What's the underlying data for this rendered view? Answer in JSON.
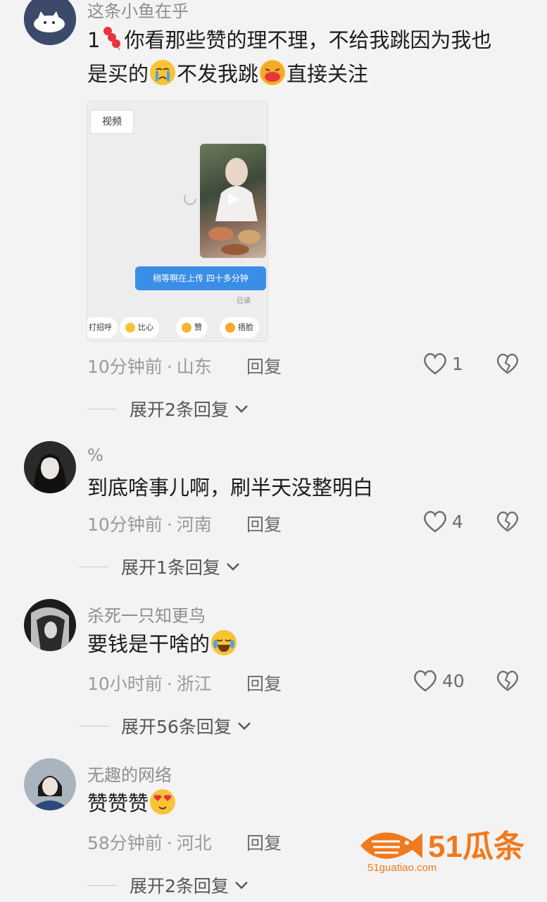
{
  "comments": [
    {
      "username": "这条小鱼在乎",
      "text_parts": [
        "1",
        "你看那些赞的理不理，不给我跳因为我也",
        "是买的",
        "不发我跳",
        "直接关注"
      ],
      "time": "10分钟前",
      "location": "山东",
      "reply_label": "回复",
      "likes": "1",
      "expand": "展开2条回复",
      "screenshot": {
        "tag": "视频",
        "bubble": "稍等啊在上传 四十多分钟",
        "read": "已读",
        "quick_replies": [
          "打招呼",
          "比心",
          "赞",
          "捂脸"
        ]
      }
    },
    {
      "username": "%",
      "text": "到底啥事儿啊，刷半天没整明白",
      "time": "10分钟前",
      "location": "河南",
      "reply_label": "回复",
      "likes": "4",
      "expand": "展开1条回复"
    },
    {
      "username": "杀死一只知更鸟",
      "text": "要钱是干啥的",
      "time": "10小时前",
      "location": "浙江",
      "reply_label": "回复",
      "likes": "40",
      "expand": "展开56条回复"
    },
    {
      "username": "无趣的网络",
      "text": "赞赞赞",
      "time": "58分钟前",
      "location": "河北",
      "reply_label": "回复",
      "likes": "",
      "expand": "展开2条回复"
    }
  ],
  "separator": "·",
  "watermark": {
    "brand": "51瓜条",
    "url": "51guatiao.com"
  },
  "icons": {
    "like": "heart-outline-icon",
    "dislike": "broken-heart-icon",
    "expand": "chevron-down-icon"
  },
  "colors": {
    "background": "#f3f3f3",
    "meta_text": "#9a9a9a",
    "watermark": "#f07a1e",
    "bubble": "#3a8ee8"
  }
}
